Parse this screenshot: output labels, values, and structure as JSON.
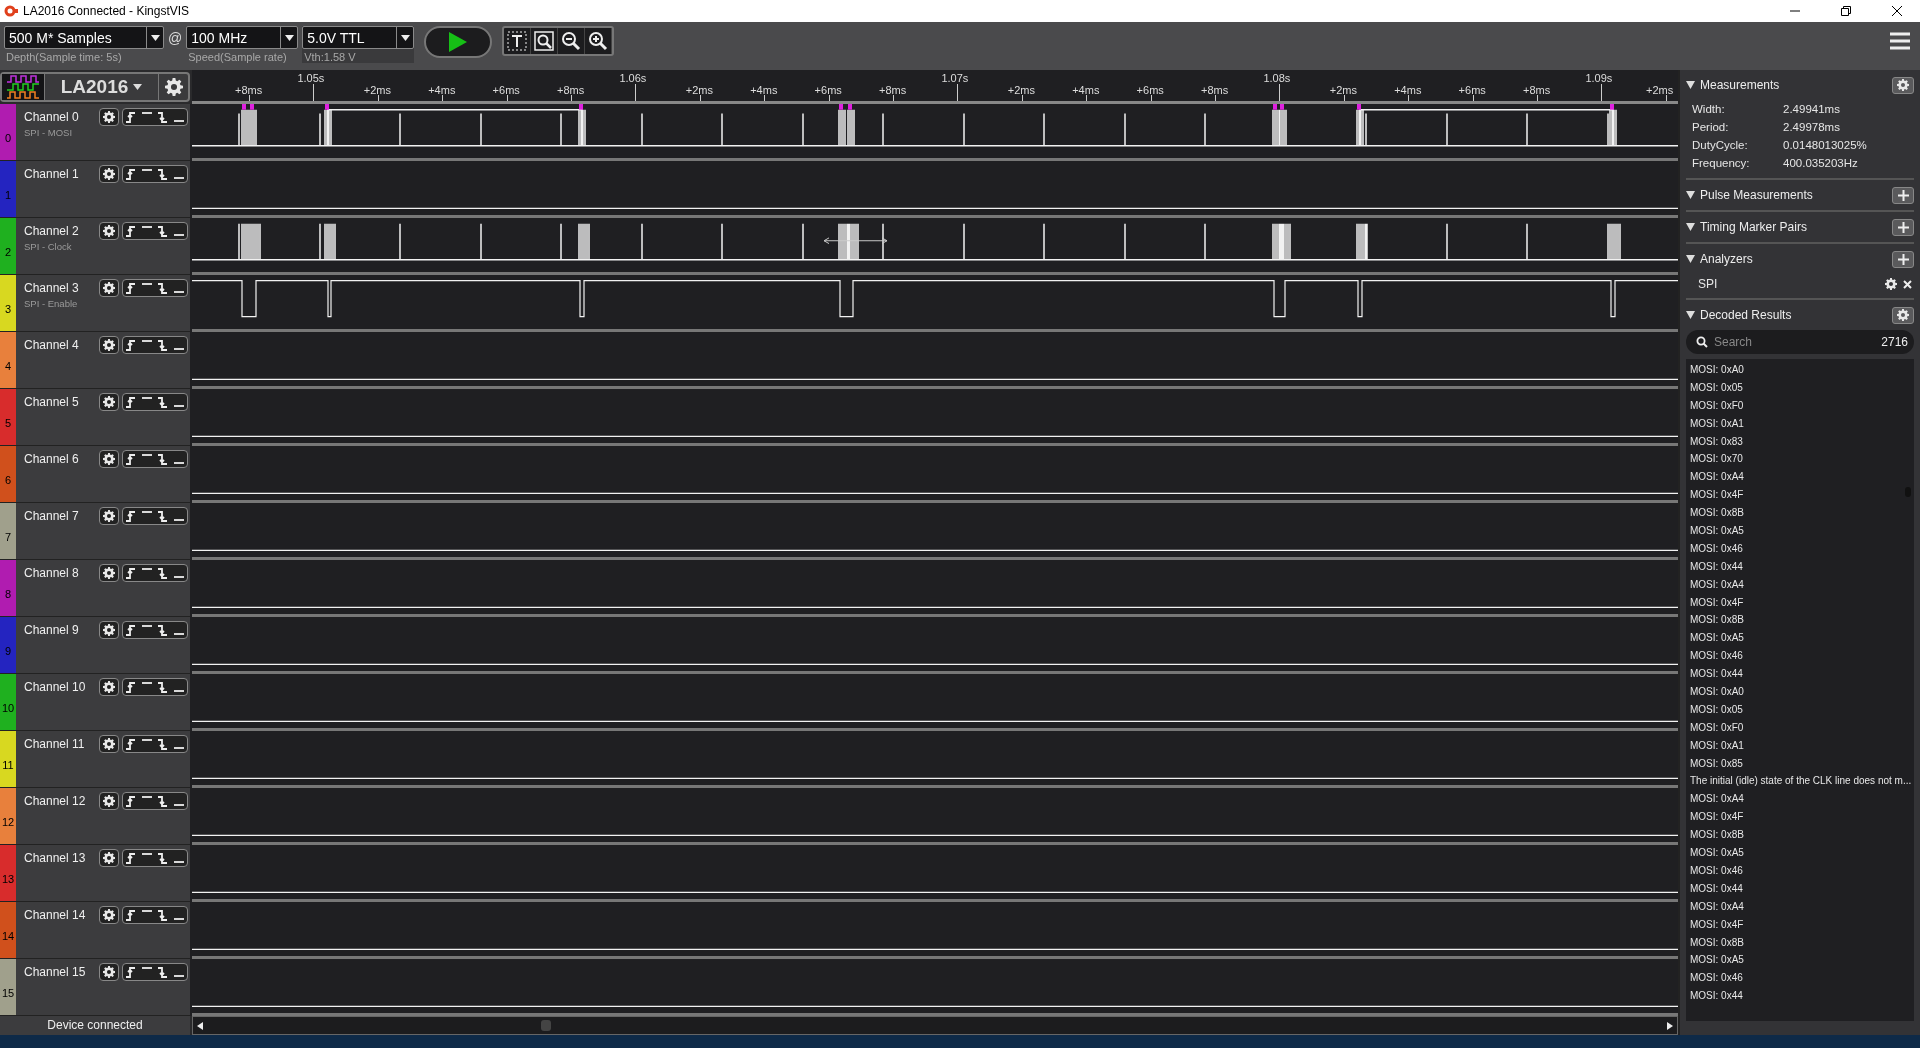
{
  "window": {
    "title": "LA2016 Connected - KingstVIS"
  },
  "toolbar": {
    "depth": {
      "value": "500 M* Samples",
      "caption": "Depth(Sample time: 5s)"
    },
    "at": "@",
    "speed": {
      "value": "100 MHz",
      "caption": "Speed(Sample rate)"
    },
    "threshold": {
      "value": "5.0V TTL",
      "caption": "Vth:1.58 V"
    }
  },
  "device": {
    "name": "LA2016"
  },
  "ruler": {
    "labels": [
      {
        "text": "+8ms",
        "kind": "minor"
      },
      {
        "text": "1.05s",
        "kind": "major"
      },
      {
        "text": "+2ms",
        "kind": "minor"
      },
      {
        "text": "+4ms",
        "kind": "minor"
      },
      {
        "text": "+6ms",
        "kind": "minor"
      },
      {
        "text": "+8ms",
        "kind": "minor"
      },
      {
        "text": "1.06s",
        "kind": "major"
      },
      {
        "text": "+2ms",
        "kind": "minor"
      },
      {
        "text": "+4ms",
        "kind": "minor"
      },
      {
        "text": "+6ms",
        "kind": "minor"
      },
      {
        "text": "+8ms",
        "kind": "minor"
      },
      {
        "text": "1.07s",
        "kind": "major"
      },
      {
        "text": "+2ms",
        "kind": "minor"
      },
      {
        "text": "+4ms",
        "kind": "minor"
      },
      {
        "text": "+6ms",
        "kind": "minor"
      },
      {
        "text": "+8ms",
        "kind": "minor"
      },
      {
        "text": "1.08s",
        "kind": "major"
      },
      {
        "text": "+2ms",
        "kind": "minor"
      },
      {
        "text": "+4ms",
        "kind": "minor"
      },
      {
        "text": "+6ms",
        "kind": "minor"
      },
      {
        "text": "+8ms",
        "kind": "minor"
      },
      {
        "text": "1.09s",
        "kind": "major"
      },
      {
        "text": "+2ms",
        "kind": "minor"
      }
    ]
  },
  "channels": [
    {
      "number": "0",
      "name": "Channel 0",
      "subtitle": "SPI - MOSI",
      "color": "#b01cb0",
      "kind": "mosi"
    },
    {
      "number": "1",
      "name": "Channel 1",
      "color": "#2424c0",
      "kind": "idle"
    },
    {
      "number": "2",
      "name": "Channel 2",
      "subtitle": "SPI - Clock",
      "color": "#1fb01f",
      "kind": "clock"
    },
    {
      "number": "3",
      "name": "Channel 3",
      "subtitle": "SPI - Enable",
      "color": "#d8d820",
      "kind": "enable"
    },
    {
      "number": "4",
      "name": "Channel 4",
      "color": "#e8803c",
      "kind": "idle"
    },
    {
      "number": "5",
      "name": "Channel 5",
      "color": "#d82c2c",
      "kind": "idle"
    },
    {
      "number": "6",
      "name": "Channel 6",
      "color": "#d0501c",
      "kind": "idle"
    },
    {
      "number": "7",
      "name": "Channel 7",
      "color": "#a0a08c",
      "kind": "idle"
    },
    {
      "number": "8",
      "name": "Channel 8",
      "color": "#b01cb0",
      "kind": "idle"
    },
    {
      "number": "9",
      "name": "Channel 9",
      "color": "#2424c0",
      "kind": "idle"
    },
    {
      "number": "10",
      "name": "Channel 10",
      "color": "#1fb01f",
      "kind": "idle"
    },
    {
      "number": "11",
      "name": "Channel 11",
      "color": "#d8d820",
      "kind": "idle"
    },
    {
      "number": "12",
      "name": "Channel 12",
      "color": "#e8803c",
      "kind": "idle"
    },
    {
      "number": "13",
      "name": "Channel 13",
      "color": "#d82c2c",
      "kind": "idle"
    },
    {
      "number": "14",
      "name": "Channel 14",
      "color": "#d0501c",
      "kind": "idle"
    },
    {
      "number": "15",
      "name": "Channel 15",
      "color": "#a0a08c",
      "kind": "idle"
    }
  ],
  "status_bar": {
    "text": "Device connected"
  },
  "panel": {
    "measurements": {
      "title": "Measurements",
      "rows": [
        {
          "label": "Width:",
          "value": "2.49941ms"
        },
        {
          "label": "Period:",
          "value": "2.49978ms"
        },
        {
          "label": "DutyCycle:",
          "value": "0.0148013025%"
        },
        {
          "label": "Frequency:",
          "value": "400.035203Hz"
        }
      ]
    },
    "pulse_measurements": {
      "title": "Pulse Measurements"
    },
    "timing_marker_pairs": {
      "title": "Timing Marker Pairs"
    },
    "analyzers": {
      "title": "Analyzers",
      "items": [
        "SPI"
      ]
    },
    "decoded_results": {
      "title": "Decoded Results",
      "placeholder": "Search",
      "count": "2716",
      "items": [
        "MOSI: 0xA0",
        "MOSI: 0x05",
        "MOSI: 0xF0",
        "MOSI: 0xA1",
        "MOSI: 0x83",
        "MOSI: 0x70",
        "MOSI: 0xA4",
        "MOSI: 0x4F",
        "MOSI: 0x8B",
        "MOSI: 0xA5",
        "MOSI: 0x46",
        "MOSI: 0x44",
        "MOSI: 0xA4",
        "MOSI: 0x4F",
        "MOSI: 0x8B",
        "MOSI: 0xA5",
        "MOSI: 0x46",
        "MOSI: 0x44",
        "MOSI: 0xA0",
        "MOSI: 0x05",
        "MOSI: 0xF0",
        "MOSI: 0xA1",
        "MOSI: 0x85",
        "The initial (idle) state of the CLK line does not m...",
        "MOSI: 0xA4",
        "MOSI: 0x4F",
        "MOSI: 0x8B",
        "MOSI: 0xA5",
        "MOSI: 0x46",
        "MOSI: 0x44",
        "MOSI: 0xA4",
        "MOSI: 0x4F",
        "MOSI: 0x8B",
        "MOSI: 0xA5",
        "MOSI: 0x46",
        "MOSI: 0x44"
      ]
    }
  }
}
